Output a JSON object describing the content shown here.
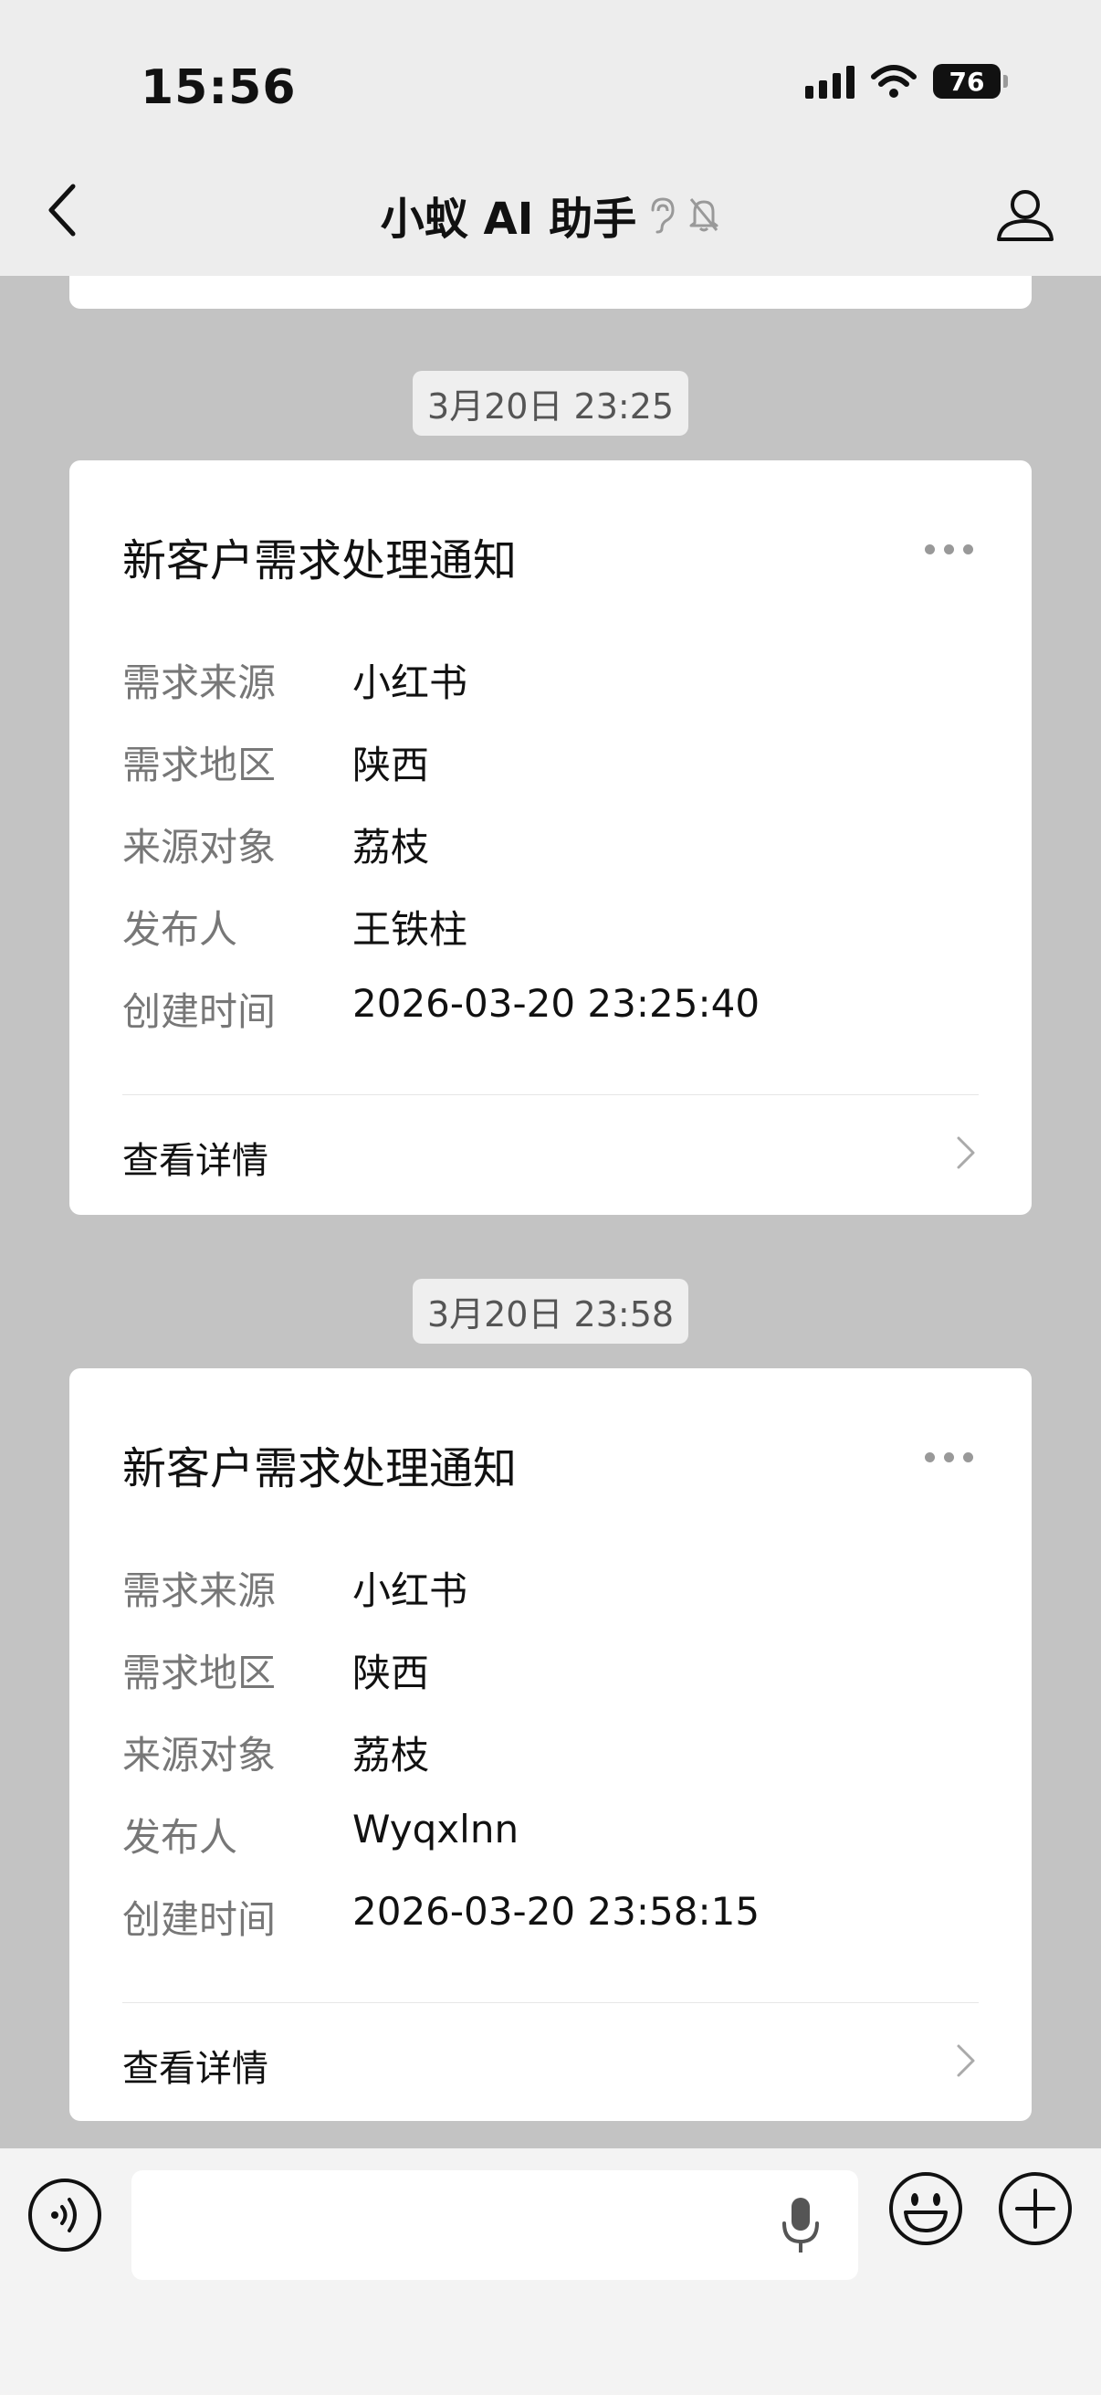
{
  "status_bar": {
    "time": "15:56",
    "battery": "76"
  },
  "nav": {
    "title": "小蚁 AI 助手"
  },
  "messages": [
    {
      "timestamp": "3月20日 23:25",
      "card": {
        "title": "新客户需求处理通知",
        "fields": [
          {
            "label": "需求来源",
            "value": "小红书"
          },
          {
            "label": "需求地区",
            "value": "陕西"
          },
          {
            "label": "来源对象",
            "value": "荔枝"
          },
          {
            "label": "发布人",
            "value": "王铁柱"
          },
          {
            "label": "创建时间",
            "value": "2026-03-20 23:25:40"
          }
        ],
        "detail_label": "查看详情"
      }
    },
    {
      "timestamp": "3月20日 23:58",
      "card": {
        "title": "新客户需求处理通知",
        "fields": [
          {
            "label": "需求来源",
            "value": "小红书"
          },
          {
            "label": "需求地区",
            "value": "陕西"
          },
          {
            "label": "来源对象",
            "value": "荔枝"
          },
          {
            "label": "发布人",
            "value": "Wyqxlnn"
          },
          {
            "label": "创建时间",
            "value": "2026-03-20 23:58:15"
          }
        ],
        "detail_label": "查看详情"
      }
    }
  ],
  "input": {
    "value": "",
    "placeholder": ""
  },
  "icons": {
    "back": "chevron-left-icon",
    "ear": "ear-icon",
    "mute": "bell-off-icon",
    "profile": "person-icon",
    "more": "more-dots-icon",
    "voice": "voice-icon",
    "mic": "mic-icon",
    "emoji": "emoji-icon",
    "plus": "plus-icon"
  }
}
